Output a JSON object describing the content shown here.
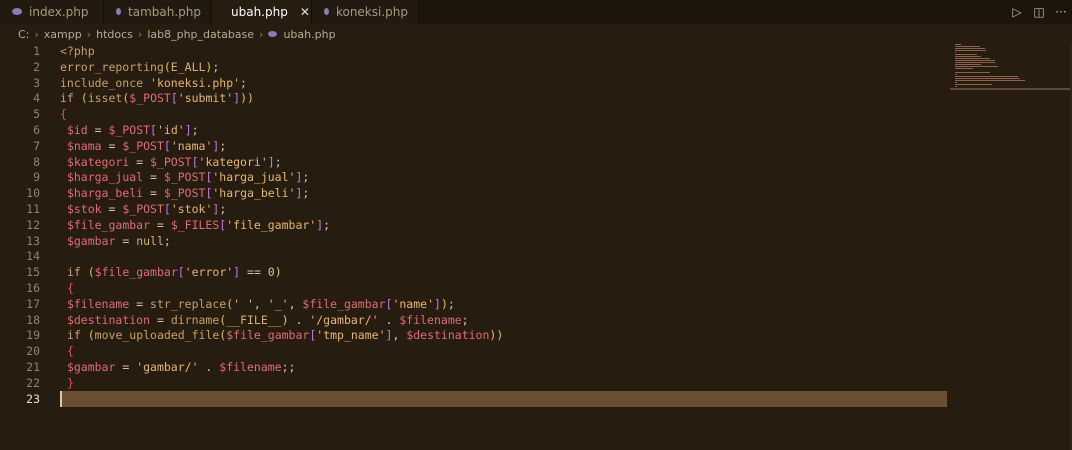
{
  "tabs": [
    {
      "label": "index.php",
      "active": false
    },
    {
      "label": "tambah.php",
      "active": false
    },
    {
      "label": "ubah.php",
      "active": true
    },
    {
      "label": "koneksi.php",
      "active": false
    }
  ],
  "tab_actions": {
    "run": "▷",
    "split": "◫",
    "more": "···"
  },
  "breadcrumb": [
    "C:",
    "xampp",
    "htdocs",
    "lab8_php_database",
    "ubah.php"
  ],
  "colors": {
    "background": "#261c10",
    "current_line": "#6a4f30",
    "variable": "#e06c75",
    "string": "#e6b673"
  },
  "current_line": 23,
  "lines": [
    {
      "n": "1",
      "t": "<?php"
    },
    {
      "n": "2",
      "t": "error_reporting(E_ALL);"
    },
    {
      "n": "3",
      "t": "include_once 'koneksi.php';"
    },
    {
      "n": "4",
      "t": "if (isset($_POST['submit']))"
    },
    {
      "n": "5",
      "t": "{"
    },
    {
      "n": "6",
      "t": " $id = $_POST['id'];"
    },
    {
      "n": "7",
      "t": " $nama = $_POST['nama'];"
    },
    {
      "n": "8",
      "t": " $kategori = $_POST['kategori'];"
    },
    {
      "n": "9",
      "t": " $harga_jual = $_POST['harga_jual'];"
    },
    {
      "n": "10",
      "t": " $harga_beli = $_POST['harga_beli'];"
    },
    {
      "n": "11",
      "t": " $stok = $_POST['stok'];"
    },
    {
      "n": "12",
      "t": " $file_gambar = $_FILES['file_gambar'];"
    },
    {
      "n": "13",
      "t": " $gambar = null;"
    },
    {
      "n": "14",
      "t": ""
    },
    {
      "n": "15",
      "t": " if ($file_gambar['error'] == 0)"
    },
    {
      "n": "16",
      "t": " {"
    },
    {
      "n": "17",
      "t": " $filename = str_replace(' ', '_', $file_gambar['name']);"
    },
    {
      "n": "18",
      "t": " $destination = dirname(__FILE__) . '/gambar/' . $filename;"
    },
    {
      "n": "19",
      "t": " if (move_uploaded_file($file_gambar['tmp_name'], $destination))"
    },
    {
      "n": "20",
      "t": " {"
    },
    {
      "n": "21",
      "t": " $gambar = 'gambar/' . $filename;;"
    },
    {
      "n": "22",
      "t": " }"
    },
    {
      "n": "23",
      "t": ""
    }
  ]
}
